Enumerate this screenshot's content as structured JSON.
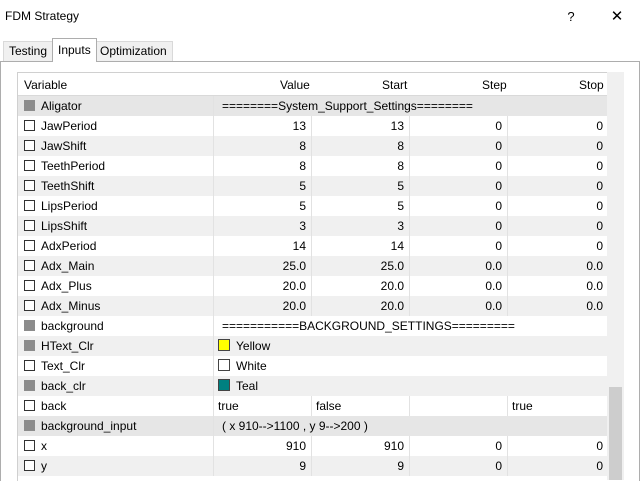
{
  "window": {
    "title": "FDM Strategy",
    "help": "?",
    "close": "✕"
  },
  "tabs": [
    {
      "label": "Testing"
    },
    {
      "label": "Inputs"
    },
    {
      "label": "Optimization"
    }
  ],
  "columns": {
    "variable": "Variable",
    "value": "Value",
    "start": "Start",
    "step": "Step",
    "stop": "Stop"
  },
  "rows": {
    "r0": {
      "name": "Aligator",
      "note": "========System_Support_Settings========"
    },
    "r1": {
      "name": "JawPeriod",
      "value": "13",
      "start": "13",
      "step": "0",
      "stop": "0"
    },
    "r2": {
      "name": "JawShift",
      "value": "8",
      "start": "8",
      "step": "0",
      "stop": "0"
    },
    "r3": {
      "name": "TeethPeriod",
      "value": "8",
      "start": "8",
      "step": "0",
      "stop": "0"
    },
    "r4": {
      "name": "TeethShift",
      "value": "5",
      "start": "5",
      "step": "0",
      "stop": "0"
    },
    "r5": {
      "name": "LipsPeriod",
      "value": "5",
      "start": "5",
      "step": "0",
      "stop": "0"
    },
    "r6": {
      "name": "LipsShift",
      "value": "3",
      "start": "3",
      "step": "0",
      "stop": "0"
    },
    "r7": {
      "name": "AdxPeriod",
      "value": "14",
      "start": "14",
      "step": "0",
      "stop": "0"
    },
    "r8": {
      "name": "Adx_Main",
      "value": "25.0",
      "start": "25.0",
      "step": "0.0",
      "stop": "0.0"
    },
    "r9": {
      "name": "Adx_Plus",
      "value": "20.0",
      "start": "20.0",
      "step": "0.0",
      "stop": "0.0"
    },
    "r10": {
      "name": "Adx_Minus",
      "value": "20.0",
      "start": "20.0",
      "step": "0.0",
      "stop": "0.0"
    },
    "r11": {
      "name": "background",
      "note": "===========BACKGROUND_SETTINGS========="
    },
    "r12": {
      "name": "HText_Clr",
      "color_name": "Yellow",
      "color": "#ffff00"
    },
    "r13": {
      "name": "Text_Clr",
      "color_name": "White",
      "color": "#ffffff"
    },
    "r14": {
      "name": "back_clr",
      "color_name": "Teal",
      "color": "#008080"
    },
    "r15": {
      "name": "back",
      "value": "true",
      "start": "false",
      "step": "",
      "stop": "true"
    },
    "r16": {
      "name": "background_input",
      "note": " ( x 910-->1100 , y 9-->200 )"
    },
    "r17": {
      "name": "x",
      "value": "910",
      "start": "910",
      "step": "0",
      "stop": "0"
    },
    "r18": {
      "name": "y",
      "value": "9",
      "start": "9",
      "step": "0",
      "stop": "0"
    }
  }
}
